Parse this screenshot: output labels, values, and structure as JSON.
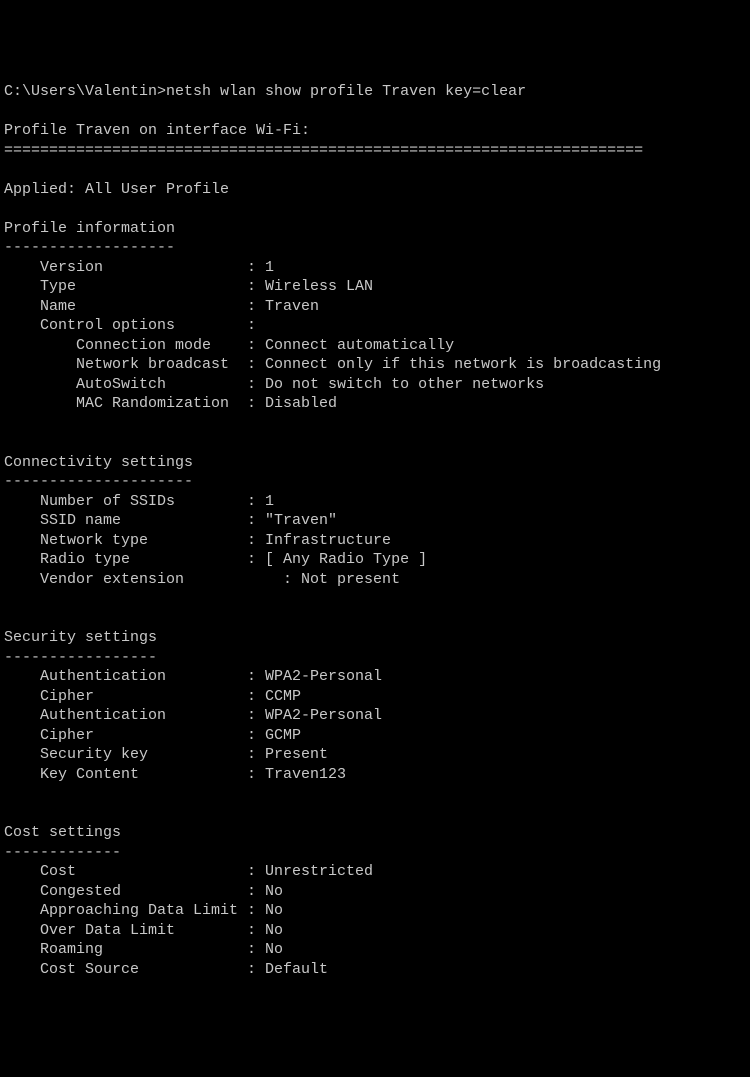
{
  "prompt": "C:\\Users\\Valentin>",
  "command": "netsh wlan show profile Traven key=clear",
  "header": "Profile Traven on interface Wi-Fi:",
  "divider": "=======================================================================",
  "applied": "Applied: All User Profile",
  "sections": {
    "profile_info": {
      "title": "Profile information",
      "dashes": "-------------------",
      "rows": [
        {
          "indent": 1,
          "label": "Version",
          "value": "1"
        },
        {
          "indent": 1,
          "label": "Type",
          "value": "Wireless LAN"
        },
        {
          "indent": 1,
          "label": "Name",
          "value": "Traven"
        },
        {
          "indent": 1,
          "label": "Control options",
          "value": ""
        },
        {
          "indent": 2,
          "label": "Connection mode",
          "value": "Connect automatically"
        },
        {
          "indent": 2,
          "label": "Network broadcast",
          "value": "Connect only if this network is broadcasting"
        },
        {
          "indent": 2,
          "label": "AutoSwitch",
          "value": "Do not switch to other networks"
        },
        {
          "indent": 2,
          "label": "MAC Randomization",
          "value": "Disabled"
        }
      ]
    },
    "connectivity": {
      "title": "Connectivity settings",
      "dashes": "---------------------",
      "rows": [
        {
          "indent": 1,
          "label": "Number of SSIDs",
          "value": "1"
        },
        {
          "indent": 1,
          "label": "SSID name",
          "value": "\"Traven\""
        },
        {
          "indent": 1,
          "label": "Network type",
          "value": "Infrastructure"
        },
        {
          "indent": 1,
          "label": "Radio type",
          "value": "[ Any Radio Type ]"
        },
        {
          "indent": 1,
          "label": "Vendor extension",
          "value": "    : Not present",
          "novalcolon": true
        }
      ]
    },
    "security": {
      "title": "Security settings",
      "dashes": "-----------------",
      "rows": [
        {
          "indent": 1,
          "label": "Authentication",
          "value": "WPA2-Personal"
        },
        {
          "indent": 1,
          "label": "Cipher",
          "value": "CCMP"
        },
        {
          "indent": 1,
          "label": "Authentication",
          "value": "WPA2-Personal"
        },
        {
          "indent": 1,
          "label": "Cipher",
          "value": "GCMP"
        },
        {
          "indent": 1,
          "label": "Security key",
          "value": "Present"
        },
        {
          "indent": 1,
          "label": "Key Content",
          "value": "Traven123"
        }
      ]
    },
    "cost": {
      "title": "Cost settings",
      "dashes": "-------------",
      "rows": [
        {
          "indent": 1,
          "label": "Cost",
          "value": "Unrestricted"
        },
        {
          "indent": 1,
          "label": "Congested",
          "value": "No"
        },
        {
          "indent": 1,
          "label": "Approaching Data Limit",
          "value": "No"
        },
        {
          "indent": 1,
          "label": "Over Data Limit",
          "value": "No"
        },
        {
          "indent": 1,
          "label": "Roaming",
          "value": "No"
        },
        {
          "indent": 1,
          "label": "Cost Source",
          "value": "Default"
        }
      ]
    }
  }
}
